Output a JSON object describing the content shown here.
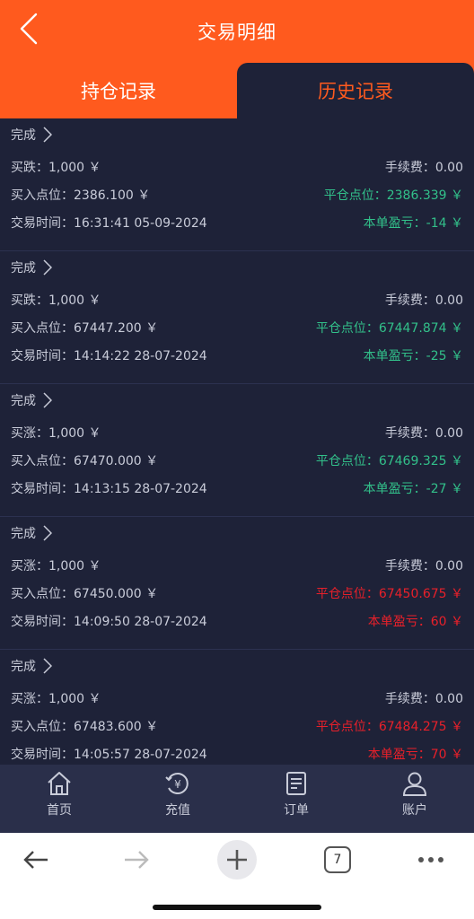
{
  "header": {
    "title": "交易明细",
    "tabs": [
      "持仓记录",
      "历史记录"
    ]
  },
  "records": [
    {
      "status": "完成",
      "direction": "买跌：1,000 ￥",
      "fee": "手续费：0.00",
      "entry": "买入点位：2386.100 ￥",
      "close": "平仓点位：2386.339 ￥",
      "time": "交易时间：16:31:41 05-09-2024",
      "pnl": "本单盈亏：-14 ￥",
      "trend": "down"
    },
    {
      "status": "完成",
      "direction": "买跌：1,000 ￥",
      "fee": "手续费：0.00",
      "entry": "买入点位：67447.200 ￥",
      "close": "平仓点位：67447.874 ￥",
      "time": "交易时间：14:14:22 28-07-2024",
      "pnl": "本单盈亏：-25 ￥",
      "trend": "down"
    },
    {
      "status": "完成",
      "direction": "买涨：1,000 ￥",
      "fee": "手续费：0.00",
      "entry": "买入点位：67470.000 ￥",
      "close": "平仓点位：67469.325 ￥",
      "time": "交易时间：14:13:15 28-07-2024",
      "pnl": "本单盈亏：-27 ￥",
      "trend": "down"
    },
    {
      "status": "完成",
      "direction": "买涨：1,000 ￥",
      "fee": "手续费：0.00",
      "entry": "买入点位：67450.000 ￥",
      "close": "平仓点位：67450.675 ￥",
      "time": "交易时间：14:09:50 28-07-2024",
      "pnl": "本单盈亏：60 ￥",
      "trend": "up"
    },
    {
      "status": "完成",
      "direction": "买涨：1,000 ￥",
      "fee": "手续费：0.00",
      "entry": "买入点位：67483.600 ￥",
      "close": "平仓点位：67484.275 ￥",
      "time": "交易时间：14:05:57 28-07-2024",
      "pnl": "本单盈亏：70 ￥",
      "trend": "up"
    }
  ],
  "tabbar": [
    {
      "label": "首页",
      "icon": "home-icon"
    },
    {
      "label": "充值",
      "icon": "recharge-icon"
    },
    {
      "label": "订单",
      "icon": "order-icon"
    },
    {
      "label": "账户",
      "icon": "account-icon"
    }
  ],
  "browser": {
    "tab_count": "7"
  },
  "colors": {
    "accent": "#ff5a1e",
    "background": "#1e2238",
    "profit": "#e8202a",
    "loss": "#32c08a"
  }
}
